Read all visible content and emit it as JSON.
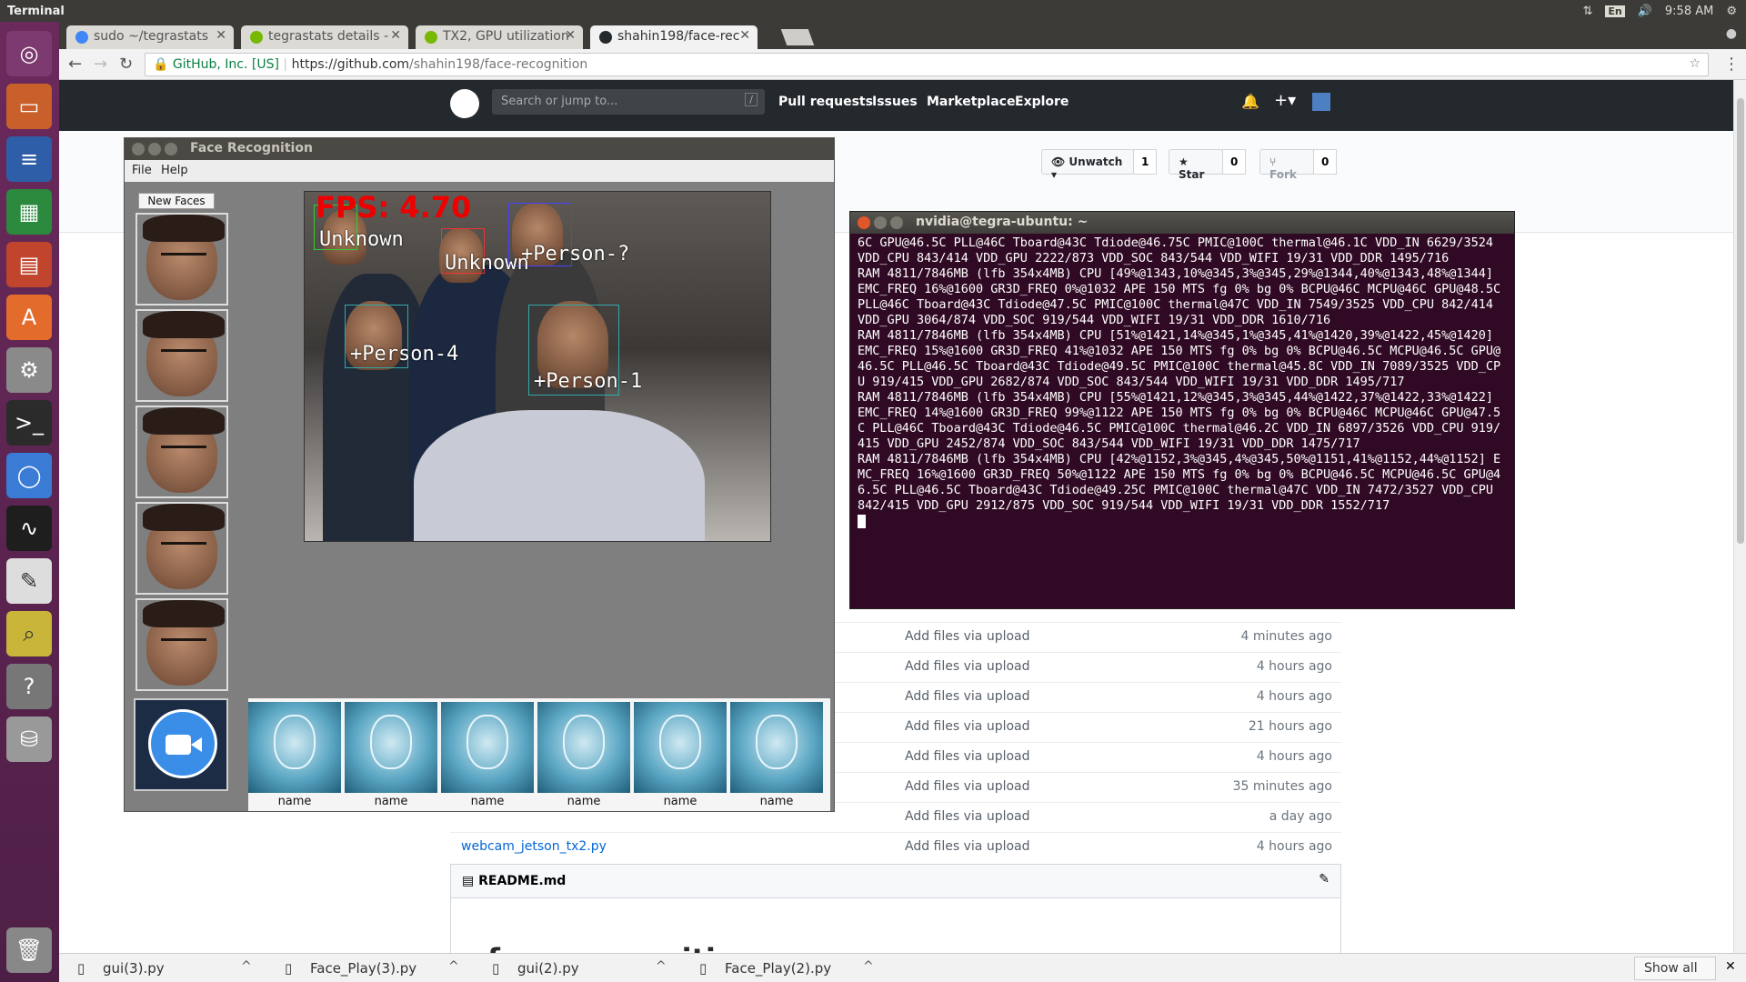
{
  "top_panel": {
    "app_title": "Terminal",
    "lang": "En",
    "time": "9:58 AM"
  },
  "launcher": {
    "items": [
      "ubuntu-icon",
      "files-icon",
      "writer-icon",
      "calc-icon",
      "impress-icon",
      "software-center-icon",
      "settings-icon",
      "terminal-icon",
      "chromium-icon",
      "system-monitor-icon",
      "text-editor-icon",
      "image-viewer-icon",
      "help-icon",
      "drive-icon",
      "trash-icon"
    ]
  },
  "browser": {
    "tabs": [
      {
        "label": "sudo ~/tegrastats",
        "favicon_color": "#4285f4"
      },
      {
        "label": "tegrastats details -",
        "favicon_color": "#76b900"
      },
      {
        "label": "TX2, GPU utilization",
        "favicon_color": "#76b900"
      },
      {
        "label": "shahin198/face-rec",
        "favicon_color": "#24292e"
      }
    ],
    "secure_label": "GitHub, Inc. [US]",
    "url_host": "https://github.com",
    "url_path": "/shahin198/face-recognition"
  },
  "github": {
    "search_placeholder": "Search or jump to...",
    "search_key": "/",
    "nav": [
      "Pull requests",
      "Issues",
      "Marketplace",
      "Explore"
    ],
    "unwatch_label": "Unwatch ▾",
    "unwatch_count": "1",
    "star_label": "Star",
    "star_count": "0",
    "fork_label": "Fork",
    "fork_count": "0",
    "files": [
      {
        "msg": "Add files via upload",
        "age": "4 minutes ago"
      },
      {
        "msg": "Add files via upload",
        "age": "4 hours ago"
      },
      {
        "msg": "Add files via upload",
        "age": "4 hours ago"
      },
      {
        "msg": "Add files via upload",
        "age": "21 hours ago"
      },
      {
        "msg": "Add files via upload",
        "age": "4 hours ago"
      },
      {
        "msg": "Add files via upload",
        "age": "35 minutes ago"
      },
      {
        "msg": "Add files via upload",
        "age": "a day ago"
      },
      {
        "name": "webcam_jetson_tx2.py",
        "msg": "Add files via upload",
        "age": "4 hours ago"
      }
    ],
    "readme_label": "README.md",
    "readme_title": "face-recognition"
  },
  "downloads": {
    "items": [
      "gui(3).py",
      "Face_Play(3).py",
      "gui(2).py",
      "Face_Play(2).py"
    ],
    "show_all": "Show all"
  },
  "face_app": {
    "title": "Face Recognition",
    "menu": [
      "File",
      "Help"
    ],
    "new_faces_label": "New Faces",
    "fps_text": "FPS: 4.70",
    "labels": [
      "Unknown",
      "Unknown",
      "+Person-?",
      "+Person-4",
      "+Person-1"
    ],
    "gallery_names": [
      "name",
      "name",
      "name",
      "name",
      "name",
      "name"
    ]
  },
  "terminal": {
    "title": "nvidia@tegra-ubuntu: ~",
    "output": "6C GPU@46.5C PLL@46C Tboard@43C Tdiode@46.75C PMIC@100C thermal@46.1C VDD_IN 6629/3524 VDD_CPU 843/414 VDD_GPU 2222/873 VDD_SOC 843/544 VDD_WIFI 19/31 VDD_DDR 1495/716\nRAM 4811/7846MB (lfb 354x4MB) CPU [49%@1343,10%@345,3%@345,29%@1344,40%@1343,48%@1344] EMC_FREQ 16%@1600 GR3D_FREQ 0%@1032 APE 150 MTS fg 0% bg 0% BCPU@46C MCPU@46C GPU@48.5C PLL@46C Tboard@43C Tdiode@47.5C PMIC@100C thermal@47C VDD_IN 7549/3525 VDD_CPU 842/414 VDD_GPU 3064/874 VDD_SOC 919/544 VDD_WIFI 19/31 VDD_DDR 1610/716\nRAM 4811/7846MB (lfb 354x4MB) CPU [51%@1421,14%@345,1%@345,41%@1420,39%@1422,45%@1420] EMC_FREQ 15%@1600 GR3D_FREQ 41%@1032 APE 150 MTS fg 0% bg 0% BCPU@46.5C MCPU@46.5C GPU@46.5C PLL@46.5C Tboard@43C Tdiode@49.5C PMIC@100C thermal@45.8C VDD_IN 7089/3525 VDD_CPU 919/415 VDD_GPU 2682/874 VDD_SOC 843/544 VDD_WIFI 19/31 VDD_DDR 1495/717\nRAM 4811/7846MB (lfb 354x4MB) CPU [55%@1421,12%@345,3%@345,44%@1422,37%@1422,33%@1422] EMC_FREQ 14%@1600 GR3D_FREQ 99%@1122 APE 150 MTS fg 0% bg 0% BCPU@46C MCPU@46C GPU@47.5C PLL@46C Tboard@43C Tdiode@46.5C PMIC@100C thermal@46.2C VDD_IN 6897/3526 VDD_CPU 919/415 VDD_GPU 2452/874 VDD_SOC 843/544 VDD_WIFI 19/31 VDD_DDR 1475/717\nRAM 4811/7846MB (lfb 354x4MB) CPU [42%@1152,3%@345,4%@345,50%@1151,41%@1152,44%@1152] EMC_FREQ 16%@1600 GR3D_FREQ 50%@1122 APE 150 MTS fg 0% bg 0% BCPU@46.5C MCPU@46.5C GPU@46.5C PLL@46.5C Tboard@43C Tdiode@49.25C PMIC@100C thermal@47C VDD_IN 7472/3527 VDD_CPU 842/415 VDD_GPU 2912/875 VDD_SOC 919/544 VDD_WIFI 19/31 VDD_DDR 1552/717\n"
  }
}
